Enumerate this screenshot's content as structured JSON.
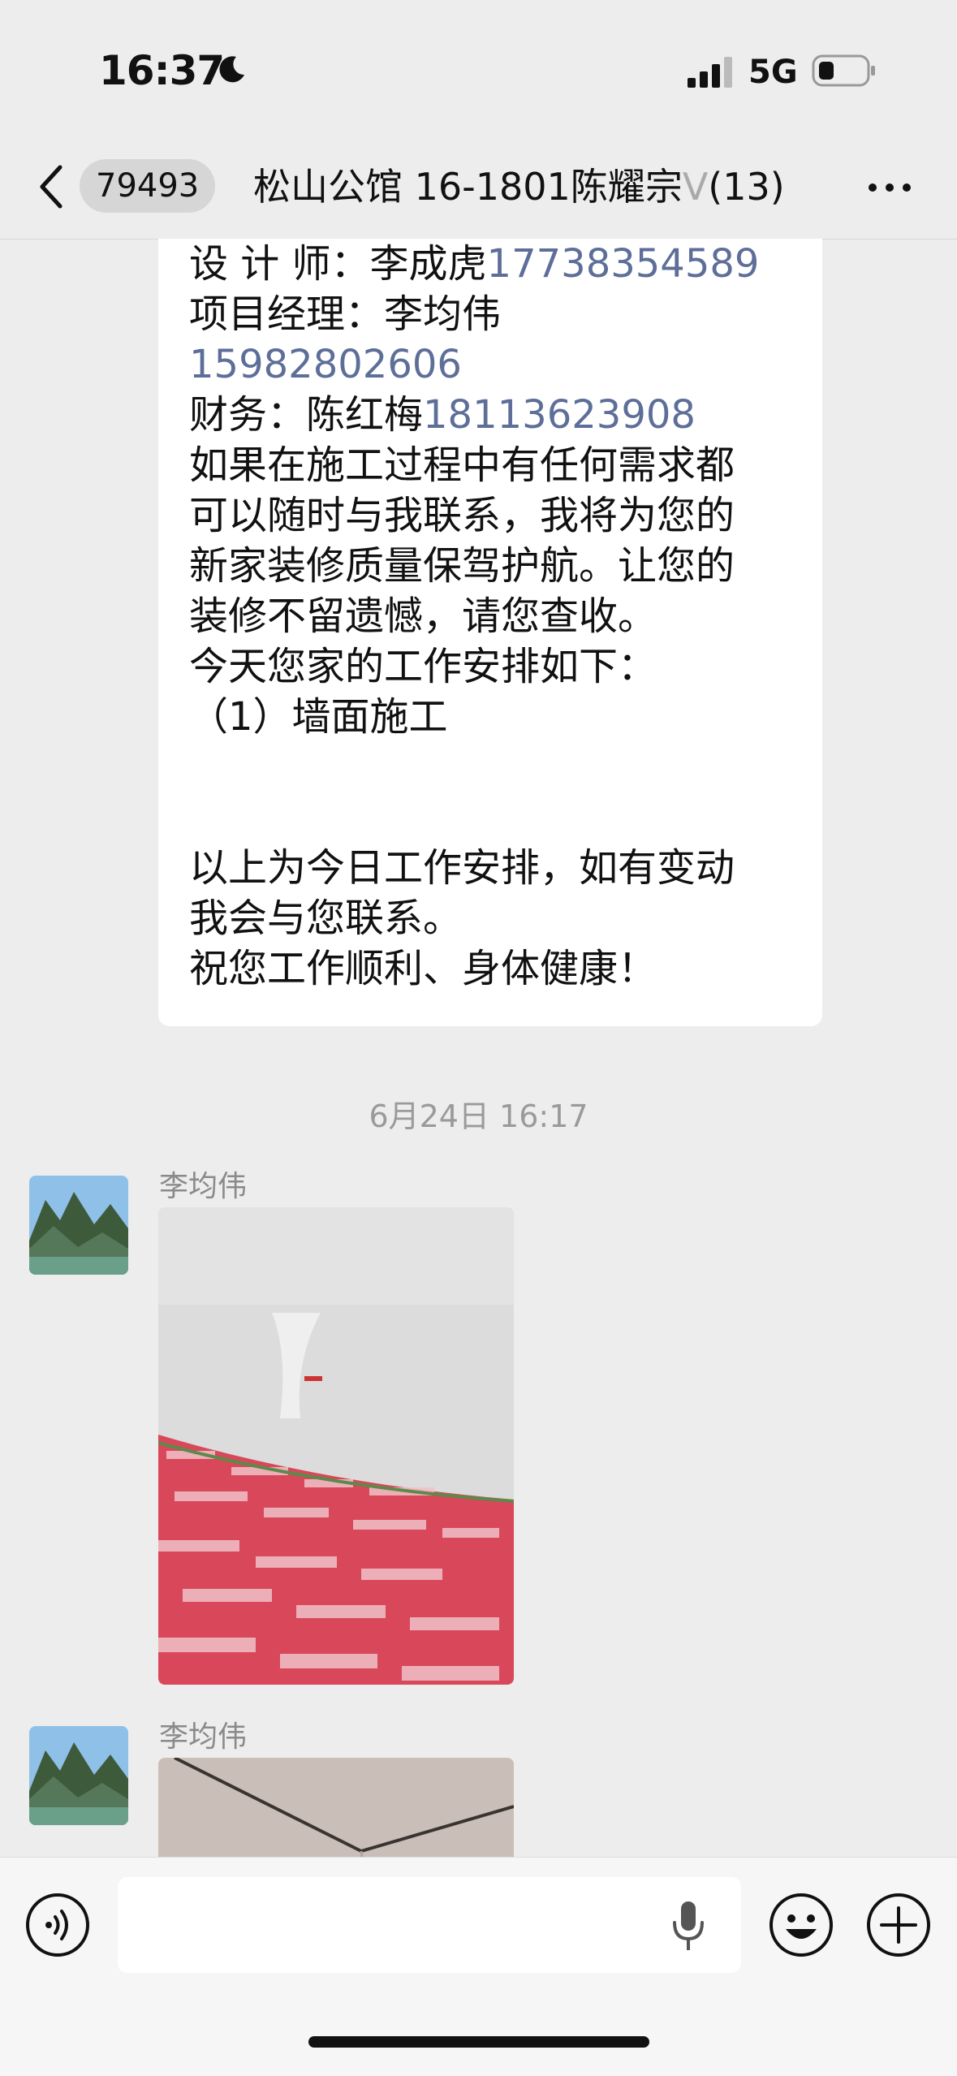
{
  "status": {
    "time": "16:37",
    "network": "5G"
  },
  "header": {
    "unread_count": "79493",
    "title": "松山公馆 16-1801陈耀宗",
    "title_suffix": "V",
    "member_count": "(13)"
  },
  "message_top": {
    "lines": {
      "l1_label": "设 计 师：李成虎",
      "l1_phone": "17738354589",
      "l2_label": "项目经理：李均伟",
      "l3_phone": "15982802606",
      "l4_label": "财务：陈红梅",
      "l4_phone": "18113623908",
      "l5": "如果在施工过程中有任何需求都",
      "l6": "可以随时与我联系，我将为您的",
      "l7": "新家装修质量保驾护航。让您的",
      "l8": "装修不留遗憾，请您查收。",
      "l9": "今天您家的工作安排如下：",
      "l10": "（1）墙面施工",
      "l11": "以上为今日工作安排，如有变动",
      "l12": "我会与您联系。",
      "l13": "祝您工作顺利、身体健康！"
    }
  },
  "timestamp": "6月24日 16:17",
  "messages": [
    {
      "sender": "李均伟"
    },
    {
      "sender": "李均伟"
    }
  ],
  "icons": {
    "back": "chevron-left-icon",
    "more": "ellipsis-icon",
    "voice": "voice-icon",
    "mic": "microphone-icon",
    "emoji": "emoji-icon",
    "plus": "plus-icon"
  }
}
